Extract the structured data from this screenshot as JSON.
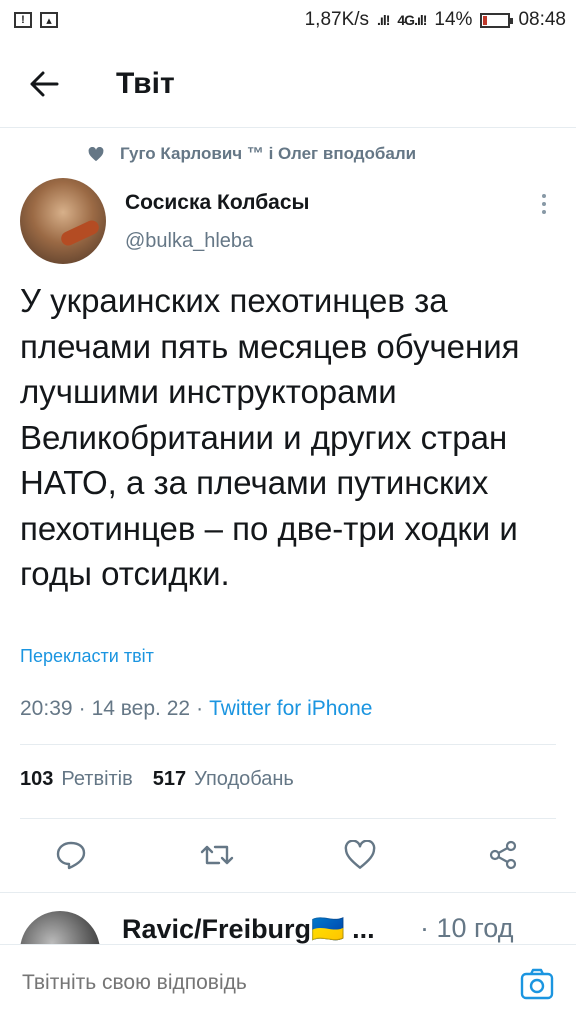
{
  "status_bar": {
    "net_speed": "1,87K/s",
    "network": "4G",
    "battery": "14%",
    "battery_level": 0.14,
    "time": "08:48"
  },
  "header": {
    "title": "Твіт"
  },
  "tweet": {
    "social_context": "Гуго Карлович ™ і Олег вподобали",
    "author_name": "Сосиска Колбасы",
    "author_handle": "@bulka_hleba",
    "text": "У украинских пехотинцев за плечами пять месяцев обучения лучшими инструкторами Великобритании и других стран НАТО, а за плечами путинских пехотинцев – по две-три ходки и годы отсидки.",
    "translate_label": "Перекласти твіт",
    "time": "20:39",
    "date": "14 вер. 22",
    "separator": "·",
    "source": "Twitter for iPhone",
    "retweets_count": "103",
    "retweets_label": "Ретвітів",
    "likes_count": "517",
    "likes_label": "Уподобань"
  },
  "next_reply": {
    "author_name": "Ravic/Freiburg🇺🇦 ...",
    "time": "· 10 год"
  },
  "compose": {
    "placeholder": "Твітніть свою відповідь"
  },
  "colors": {
    "accent": "#1b95e0",
    "muted": "#657786",
    "divider": "#e6ecf0"
  }
}
